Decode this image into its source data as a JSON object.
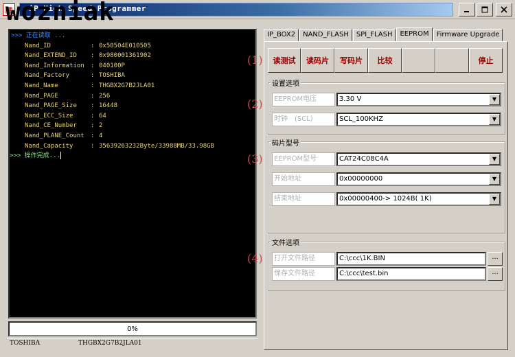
{
  "window": {
    "title": "iP High Speed Programmer",
    "watermark": "wozniak",
    "app_icon": "grid-app-icon",
    "controls": [
      "minimize-icon",
      "maximize-icon",
      "close-icon"
    ],
    "title_color": "#0a246a"
  },
  "console": {
    "prompt_line": ">>> 正在读取 ...",
    "rows": [
      {
        "key": "Nand_ID",
        "value": "0x50504E010505"
      },
      {
        "key": "Nand_EXTEND_ID",
        "value": "0x980001361902"
      },
      {
        "key": "Nand_Information",
        "value": "040100P"
      },
      {
        "key": "Nand_Factory",
        "value": "TOSHIBA"
      },
      {
        "key": "Nand_Name",
        "value": "THGBX2G7B2JLA01"
      },
      {
        "key": "Nand_PAGE",
        "value": "256"
      },
      {
        "key": "Nand_PAGE_Size",
        "value": "16448"
      },
      {
        "key": "Nand_ECC_Size",
        "value": "64"
      },
      {
        "key": "Nand_CE_Number",
        "value": "2"
      },
      {
        "key": "Nand_PLANE_Count",
        "value": "4"
      },
      {
        "key": "Nand_Capacity",
        "value": "35639263232Byte/33988MB/33.98GB"
      }
    ],
    "done_line": ">>> 操作完成...",
    "text_color": "#e6d27a",
    "prompt_color": "#3d8ef8",
    "done_color": "#8ee68e"
  },
  "progress": {
    "label": "0%",
    "value": 0
  },
  "status": {
    "vendor": "TOSHIBA",
    "chip": "THGBX2G7B2JLA01"
  },
  "tabs": [
    {
      "label": "IP_BOX2",
      "active": false
    },
    {
      "label": "NAND_FLASH",
      "active": false
    },
    {
      "label": "SPI_FLASH",
      "active": false
    },
    {
      "label": "EEPROM",
      "active": true
    },
    {
      "label": "Firmware Upgrade",
      "active": false
    }
  ],
  "actions": {
    "read_test": "读测试",
    "read_chip": "读码片",
    "write_chip": "写码片",
    "compare": "比较",
    "stop": "停止"
  },
  "markers": {
    "one": "(1)",
    "two": "(2)",
    "three": "(3)",
    "four": "(4)"
  },
  "settings": {
    "title": "设置选项",
    "voltage_label": "EEPROM电压",
    "voltage_value": "3.30 V",
    "clock_label": "时钟　(SCL)",
    "clock_value": "SCL_100KHZ"
  },
  "chip": {
    "title": "码片型号",
    "model_label": "EEPROM型号",
    "model_value": "CAT24C08C4A",
    "start_label": "开始地址",
    "start_value": "0x00000000",
    "end_label": "结束地址",
    "end_value": "0x00000400-> 1024B( 1K)"
  },
  "files": {
    "title": "文件选项",
    "open_label": "打开文件路径",
    "open_value": "C:\\ccc\\1K.BIN",
    "save_label": "保存文件路径",
    "save_value": "C:\\ccc\\test.bin",
    "browse_label": "..."
  },
  "accent_color": "#9a0000",
  "marker_color": "#c0504d"
}
